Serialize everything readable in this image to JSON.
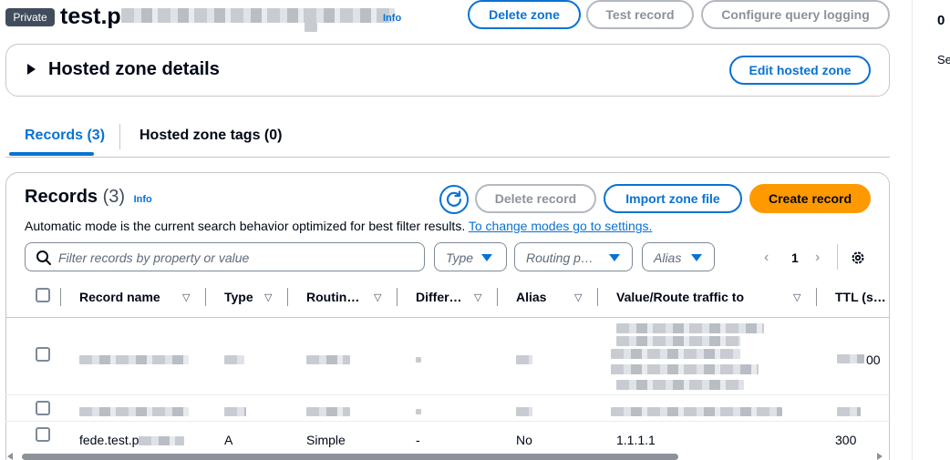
{
  "header": {
    "badge": "Private",
    "title_visible": "test.p",
    "info": "Info",
    "buttons": {
      "delete_zone": "Delete zone",
      "test_record": "Test record",
      "configure_query_logging": "Configure query logging"
    }
  },
  "right_panel": {
    "number": "0",
    "text": "Se"
  },
  "details": {
    "title": "Hosted zone details",
    "edit_button": "Edit hosted zone"
  },
  "tabs": [
    {
      "label": "Records (3)",
      "active": true
    },
    {
      "label": "Hosted zone tags (0)",
      "active": false
    }
  ],
  "records": {
    "title": "Records",
    "count": "(3)",
    "info": "Info",
    "buttons": {
      "delete_record": "Delete record",
      "import_zone_file": "Import zone file",
      "create_record": "Create record"
    },
    "description": "Automatic mode is the current search behavior optimized for best filter results.",
    "description_link": "To change modes go to settings.",
    "search_placeholder": "Filter records by property or value",
    "filters": {
      "type": "Type",
      "routing": "Routing p…",
      "alias": "Alias"
    },
    "pagination": {
      "prev": "‹",
      "page": "1",
      "next": "›"
    },
    "columns": [
      "Record name",
      "Type",
      "Routin…",
      "Differ…",
      "Alias",
      "Value/Route traffic to",
      "TTL (s…"
    ],
    "rows": [
      {
        "name": "",
        "type": "",
        "routing": "",
        "differ": "",
        "alias": "",
        "value": "",
        "ttl_visible": "00"
      },
      {
        "name": "",
        "type": "",
        "routing": "",
        "differ": "",
        "alias": "",
        "value": "",
        "ttl_visible": ""
      },
      {
        "name": "fede.test.p",
        "type": "A",
        "routing": "Simple",
        "differ": "-",
        "alias": "No",
        "value": "1.1.1.1",
        "ttl": "300"
      }
    ]
  },
  "icons": {
    "refresh": "refresh-icon",
    "search": "search-icon",
    "settings": "gear-icon",
    "caret": "caret-down-icon",
    "sort": "sort-down-icon"
  },
  "colors": {
    "primary": "#0972d3",
    "accent_orange": "#ff9900",
    "badge_bg": "#414d5c",
    "text": "#000716"
  }
}
